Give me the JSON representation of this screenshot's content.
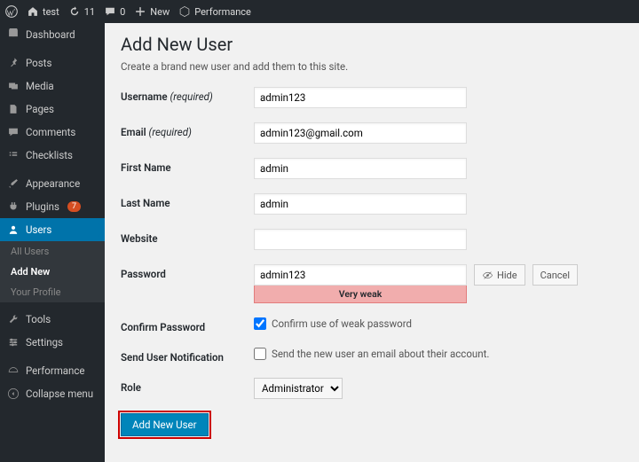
{
  "toolbar": {
    "site_name": "test",
    "updates": "11",
    "comments": "0",
    "new": "New",
    "performance": "Performance"
  },
  "sidebar": {
    "items": [
      {
        "label": "Dashboard"
      },
      {
        "label": "Posts"
      },
      {
        "label": "Media"
      },
      {
        "label": "Pages"
      },
      {
        "label": "Comments"
      },
      {
        "label": "Checklists"
      },
      {
        "label": "Appearance"
      },
      {
        "label": "Plugins",
        "badge": "7"
      },
      {
        "label": "Users"
      },
      {
        "label": "Tools"
      },
      {
        "label": "Settings"
      },
      {
        "label": "Performance"
      },
      {
        "label": "Collapse menu"
      }
    ],
    "users_submenu": {
      "all": "All Users",
      "add": "Add New",
      "profile": "Your Profile"
    }
  },
  "page": {
    "title": "Add New User",
    "description": "Create a brand new user and add them to this site.",
    "labels": {
      "username": "Username",
      "required": "(required)",
      "email": "Email",
      "first_name": "First Name",
      "last_name": "Last Name",
      "website": "Website",
      "password": "Password",
      "confirm_password": "Confirm Password",
      "send_notification": "Send User Notification",
      "role": "Role"
    },
    "values": {
      "username": "admin123",
      "email": "admin123@gmail.com",
      "first_name": "admin",
      "last_name": "admin",
      "website": "",
      "password": "admin123",
      "strength": "Very weak",
      "confirm_text": "Confirm use of weak password",
      "notification_text": "Send the new user an email about their account.",
      "role": "Administrator"
    },
    "buttons": {
      "hide": "Hide",
      "cancel": "Cancel",
      "submit": "Add New User"
    }
  }
}
